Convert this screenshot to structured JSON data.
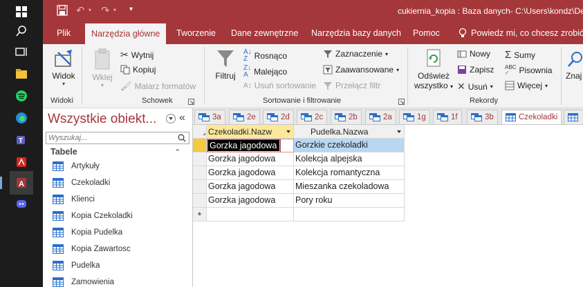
{
  "window": {
    "title": "cukiernia_kopia : Baza danych- C:\\Users\\kondz\\Des"
  },
  "ribbon_tabs": [
    "Plik",
    "Narzędzia główne",
    "Tworzenie",
    "Dane zewnętrzne",
    "Narzędzia bazy danych",
    "Pomoc"
  ],
  "tell_me": "Powiedz mi, co chcesz zrobić",
  "ribbon": {
    "widoki": {
      "label": "Widoki",
      "view": "Widok"
    },
    "schowek": {
      "label": "Schowek",
      "paste": "Wklej",
      "cut": "Wytnij",
      "copy": "Kopiuj",
      "format_painter": "Malarz formatów"
    },
    "sort": {
      "label": "Sortowanie i filtrowanie",
      "filter": "Filtruj",
      "asc": "Rosnąco",
      "desc": "Malejąco",
      "remove_sort": "Usuń sortowanie",
      "selection": "Zaznaczenie",
      "advanced": "Zaawansowane",
      "toggle_filter": "Przełącz filtr"
    },
    "records": {
      "label": "Rekordy",
      "refresh_line1": "Odśwież",
      "refresh_line2": "wszystko",
      "new": "Nowy",
      "save": "Zapisz",
      "delete": "Usuń",
      "totals": "Sumy",
      "spelling": "Pisownia",
      "more": "Więcej"
    },
    "find": {
      "label": "Znaj"
    }
  },
  "nav_pane": {
    "title": "Wszystkie obiekt...",
    "search_placeholder": "Wyszukaj...",
    "section": "Tabele",
    "items": [
      "Artykuły",
      "Czekoladki",
      "Klienci",
      "Kopia Czekoladki",
      "Kopia Pudelka",
      "Kopia Zawartosc",
      "Pudelka",
      "Zamowienia"
    ]
  },
  "object_tabs": [
    "3a",
    "2e",
    "2d",
    "2c",
    "2b",
    "2a",
    "1g",
    "1f",
    "3b",
    "Czekoladki",
    ""
  ],
  "datasheet": {
    "columns": [
      "Czekoladki.Nazw",
      "Pudelka.Nazwa"
    ],
    "rows": [
      [
        "Gorzka jagodowa",
        "Gorzkie czekoladki"
      ],
      [
        "Gorzka jagodowa",
        "Kolekcja alpejska"
      ],
      [
        "Gorzka jagodowa",
        "Kolekcja romantyczna"
      ],
      [
        "Gorzka jagodowa",
        "Mieszanka czekoladowa"
      ],
      [
        "Gorzka jagodowa",
        "Pory roku"
      ]
    ],
    "new_row_marker": "*"
  },
  "colors": {
    "access_red": "#a4373a",
    "ribbon_bg": "#f3f3f3",
    "header_highlight": "#fce89a",
    "selected_cell": "#b8d7f2",
    "current_row_marker": "#f5c940"
  }
}
